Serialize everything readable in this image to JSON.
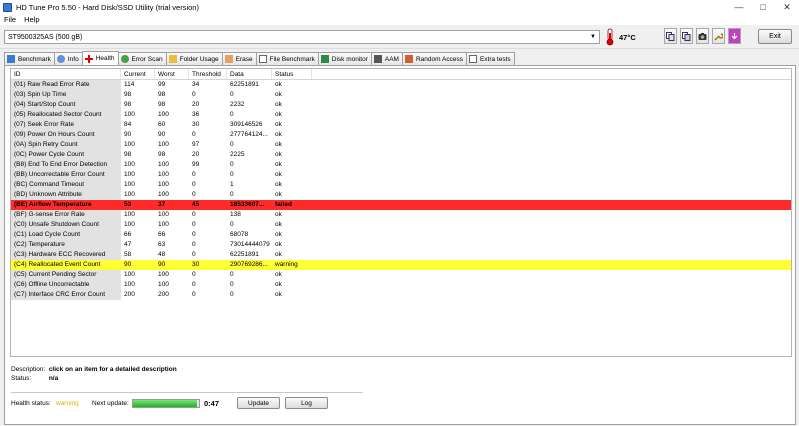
{
  "window": {
    "title": "HD Tune Pro 5.50 - Hard Disk/SSD Utility (trial version)"
  },
  "menu": [
    "File",
    "Help"
  ],
  "toolbar": {
    "drive": "ST9500325AS (500 gB)",
    "temperature": "47°C",
    "exit_label": "Exit"
  },
  "tabs": [
    {
      "label": "Benchmark",
      "icon": "benchmark-icon"
    },
    {
      "label": "Info",
      "icon": "info-icon"
    },
    {
      "label": "Health",
      "icon": "health-icon"
    },
    {
      "label": "Error Scan",
      "icon": "error-scan-icon"
    },
    {
      "label": "Folder Usage",
      "icon": "folder-icon"
    },
    {
      "label": "Erase",
      "icon": "erase-icon"
    },
    {
      "label": "File Benchmark",
      "icon": "file-benchmark-icon"
    },
    {
      "label": "Disk monitor",
      "icon": "disk-monitor-icon"
    },
    {
      "label": "AAM",
      "icon": "speaker-icon"
    },
    {
      "label": "Random Access",
      "icon": "random-access-icon"
    },
    {
      "label": "Extra tests",
      "icon": "extra-tests-icon"
    }
  ],
  "active_tab": "Health",
  "table": {
    "columns": [
      "ID",
      "Current",
      "Worst",
      "Threshold",
      "Data",
      "Status"
    ],
    "rows": [
      {
        "id": "(01) Raw Read Error Rate",
        "current": "114",
        "worst": "99",
        "threshold": "34",
        "data": "62251891",
        "status": "ok"
      },
      {
        "id": "(03) Spin Up Time",
        "current": "98",
        "worst": "98",
        "threshold": "0",
        "data": "0",
        "status": "ok"
      },
      {
        "id": "(04) Start/Stop Count",
        "current": "98",
        "worst": "98",
        "threshold": "20",
        "data": "2232",
        "status": "ok"
      },
      {
        "id": "(05) Reallocated Sector Count",
        "current": "100",
        "worst": "100",
        "threshold": "36",
        "data": "0",
        "status": "ok"
      },
      {
        "id": "(07) Seek Error Rate",
        "current": "84",
        "worst": "60",
        "threshold": "30",
        "data": "309146526",
        "status": "ok"
      },
      {
        "id": "(09) Power On Hours Count",
        "current": "90",
        "worst": "90",
        "threshold": "0",
        "data": "277764124...",
        "status": "ok"
      },
      {
        "id": "(0A) Spin Retry Count",
        "current": "100",
        "worst": "100",
        "threshold": "97",
        "data": "0",
        "status": "ok"
      },
      {
        "id": "(0C) Power Cycle Count",
        "current": "98",
        "worst": "98",
        "threshold": "20",
        "data": "2225",
        "status": "ok"
      },
      {
        "id": "(B8) End To End Error Detection",
        "current": "100",
        "worst": "100",
        "threshold": "99",
        "data": "0",
        "status": "ok"
      },
      {
        "id": "(BB) Uncorrectable Error Count",
        "current": "100",
        "worst": "100",
        "threshold": "0",
        "data": "0",
        "status": "ok"
      },
      {
        "id": "(BC) Command Timeout",
        "current": "100",
        "worst": "100",
        "threshold": "0",
        "data": "1",
        "status": "ok"
      },
      {
        "id": "(BD) Unknown Attribute",
        "current": "100",
        "worst": "100",
        "threshold": "0",
        "data": "0",
        "status": "ok"
      },
      {
        "id": "(BE) Airflow Temperature",
        "current": "53",
        "worst": "37",
        "threshold": "45",
        "data": "18533607...",
        "status": "failed"
      },
      {
        "id": "(BF) G-sense Error Rate",
        "current": "100",
        "worst": "100",
        "threshold": "0",
        "data": "138",
        "status": "ok"
      },
      {
        "id": "(C0) Unsafe Shutdown Count",
        "current": "100",
        "worst": "100",
        "threshold": "0",
        "data": "0",
        "status": "ok"
      },
      {
        "id": "(C1) Load Cycle Count",
        "current": "66",
        "worst": "66",
        "threshold": "0",
        "data": "68078",
        "status": "ok"
      },
      {
        "id": "(C2) Temperature",
        "current": "47",
        "worst": "63",
        "threshold": "0",
        "data": "73014444079",
        "status": "ok"
      },
      {
        "id": "(C3) Hardware ECC Recovered",
        "current": "58",
        "worst": "48",
        "threshold": "0",
        "data": "62251891",
        "status": "ok"
      },
      {
        "id": "(C4) Reallocated Event Count",
        "current": "90",
        "worst": "90",
        "threshold": "30",
        "data": "290769286...",
        "status": "warning"
      },
      {
        "id": "(C5) Current Pending Sector",
        "current": "100",
        "worst": "100",
        "threshold": "0",
        "data": "0",
        "status": "ok"
      },
      {
        "id": "(C6) Offline Uncorrectable",
        "current": "100",
        "worst": "100",
        "threshold": "0",
        "data": "0",
        "status": "ok"
      },
      {
        "id": "(C7) Interface CRC Error Count",
        "current": "200",
        "worst": "200",
        "threshold": "0",
        "data": "0",
        "status": "ok"
      }
    ]
  },
  "description": {
    "label": "Description:",
    "value": "click on an item for a detailed description"
  },
  "status": {
    "label": "Status:",
    "value": "n/a"
  },
  "footer": {
    "health_label": "Health status:",
    "health_value": "warning",
    "next_update_label": "Next update:",
    "progress_percent": 97,
    "countdown": "0:47",
    "update_label": "Update",
    "log_label": "Log"
  },
  "colors": {
    "failed_row": "#ff2a2a",
    "warning_row": "#ffff33",
    "warning_text": "#e0b000",
    "progress": "#1cb51c"
  }
}
